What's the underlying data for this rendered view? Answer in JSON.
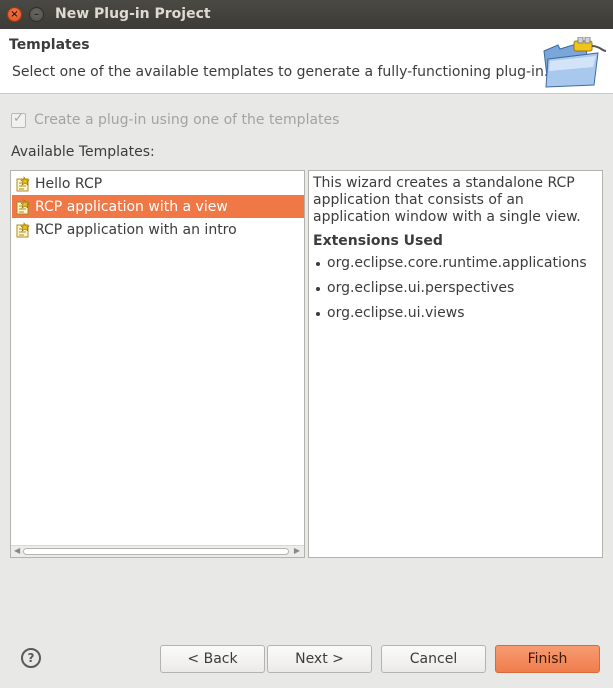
{
  "window": {
    "title": "New Plug-in Project",
    "close_glyph": "×",
    "minimize_glyph": "–"
  },
  "banner": {
    "title": "Templates",
    "description": "Select one of the available templates to generate a fully-functioning plug-in.",
    "icon": "folder-plug-wizard-icon"
  },
  "checkbox": {
    "label": "Create a plug-in using one of the templates",
    "checked": true,
    "enabled": false
  },
  "templates": {
    "label": "Available Templates:",
    "items": [
      {
        "label": "Hello RCP",
        "icon": "template-icon",
        "selected": false
      },
      {
        "label": "RCP application with a view",
        "icon": "template-icon",
        "selected": true
      },
      {
        "label": "RCP application with an intro",
        "icon": "template-icon",
        "selected": false
      }
    ],
    "scroll_left": "◀",
    "scroll_right": "▶"
  },
  "description": {
    "text": "This wizard creates a standalone RCP application that consists of an application window with a single view.",
    "extensions_title": "Extensions Used",
    "extensions": [
      "org.eclipse.core.runtime.applications",
      "org.eclipse.ui.perspectives",
      "org.eclipse.ui.views"
    ]
  },
  "buttons": {
    "help": "?",
    "back": "< Back",
    "next": "Next >",
    "cancel": "Cancel",
    "finish": "Finish"
  },
  "colors": {
    "selection": "#f07746",
    "finish": "#f28a5c",
    "titlebar": "#3c3b37"
  }
}
